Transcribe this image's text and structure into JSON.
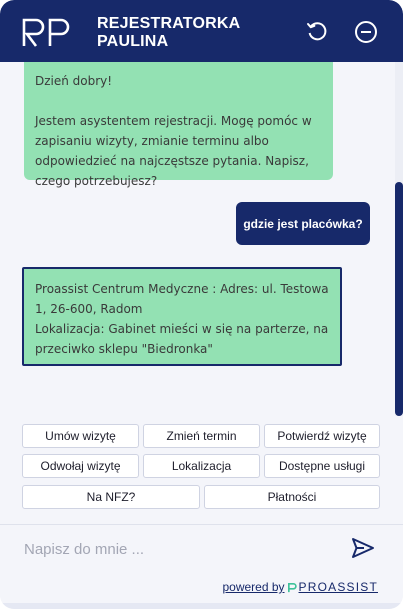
{
  "header": {
    "title_line1": "REJESTRATORKA",
    "title_line2": "PAULINA",
    "refresh_label": "refresh-icon",
    "minimize_label": "minimize-icon"
  },
  "messages": [
    {
      "from": "bot",
      "paragraphs": [
        "Dzień dobry!",
        "Jestem asystentem rejestracji. Mogę pomóc w zapisaniu wizyty, zmianie terminu albo odpowiedzieć na najczęstsze pytania. Napisz, czego potrzebujesz?"
      ]
    },
    {
      "from": "user",
      "text": "gdzie jest placówka?"
    },
    {
      "from": "bot",
      "paragraphs": [
        "Proassist Centrum Medyczne : Adres: ul. Testowa 1, 26-600, Radom\nLokalizacja: Gabinet mieści w się na parterze, na przeciwko sklepu \"Biedronka\""
      ]
    }
  ],
  "quick_replies": [
    "Umów wizytę",
    "Zmień termin",
    "Potwierdź wizytę",
    "Odwołaj wizytę",
    "Lokalizacja",
    "Dostępne usługi",
    "Na NFZ?",
    "Płatności"
  ],
  "input": {
    "placeholder": "Napisz do mnie ..."
  },
  "footer": {
    "powered_by": "powered by",
    "brand": "PROASSIST"
  },
  "colors": {
    "primary": "#17296a",
    "bot_bubble": "#93e1b3",
    "background": "#f4f5fa"
  }
}
